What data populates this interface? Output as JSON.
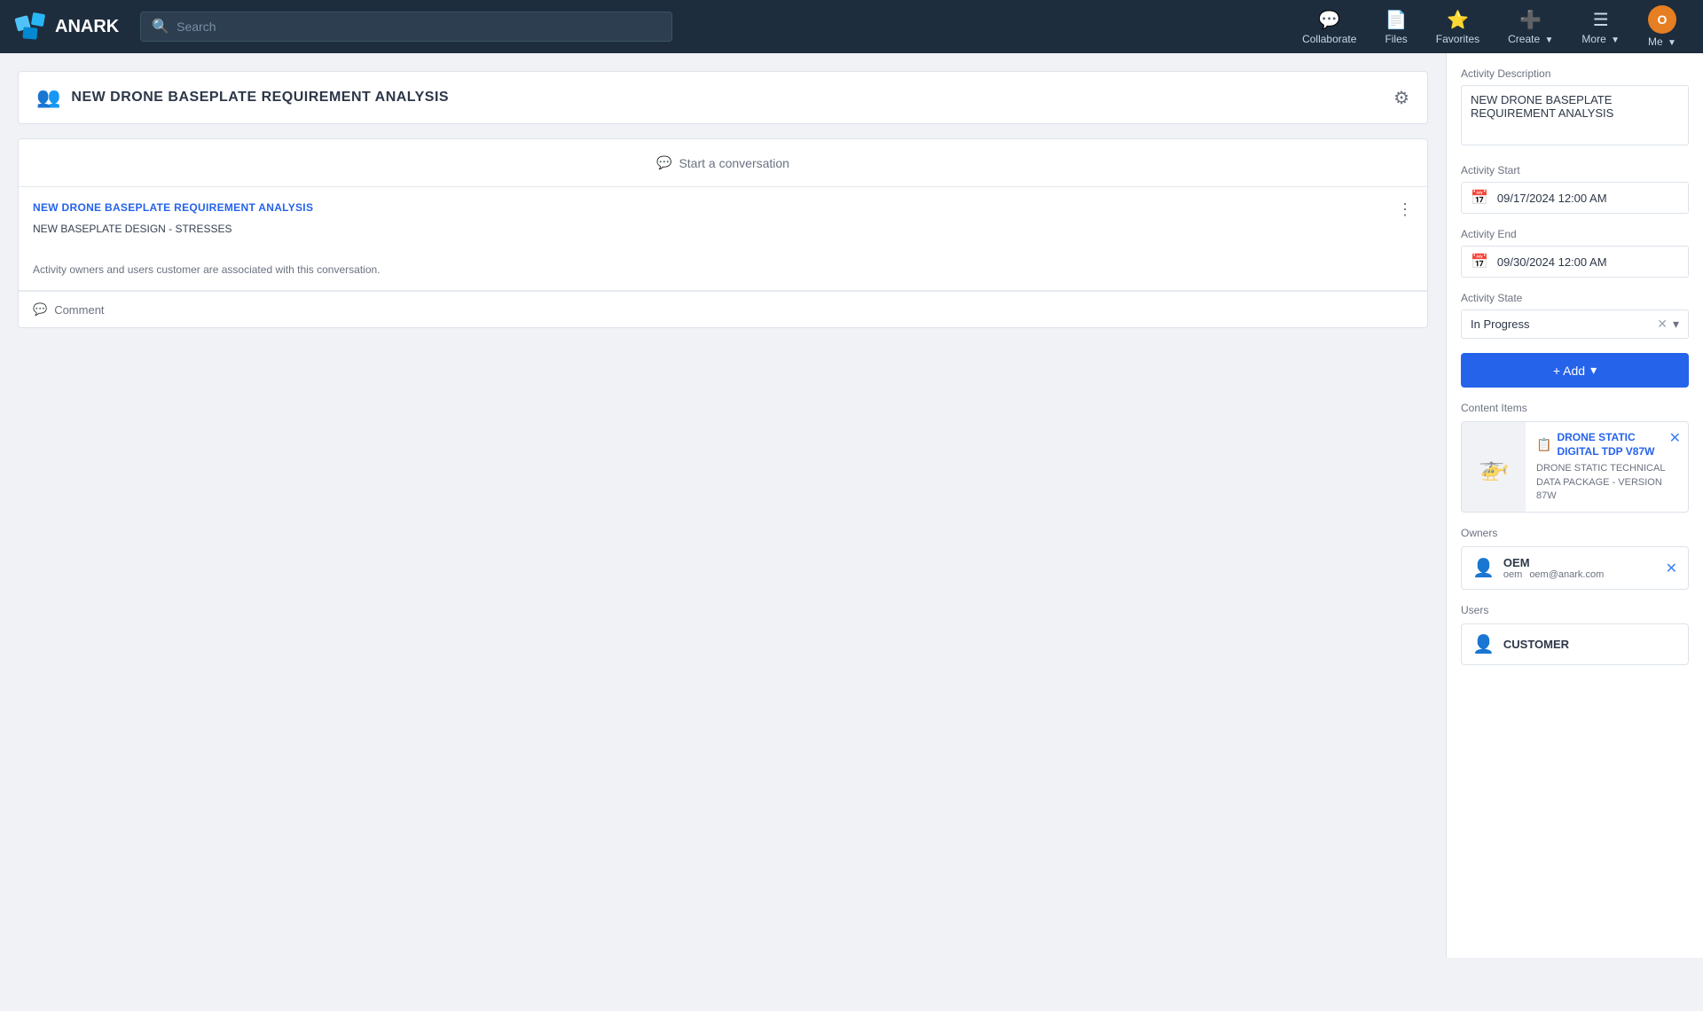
{
  "nav": {
    "logo_text": "ANARK",
    "search_placeholder": "Search",
    "items": [
      {
        "id": "collaborate",
        "label": "Collaborate",
        "icon": "💬"
      },
      {
        "id": "files",
        "label": "Files",
        "icon": "📄"
      },
      {
        "id": "favorites",
        "label": "Favorites",
        "icon": "⭐"
      },
      {
        "id": "create",
        "label": "Create",
        "icon": "➕",
        "has_dropdown": true
      },
      {
        "id": "more",
        "label": "More",
        "icon": "☰",
        "has_dropdown": true
      },
      {
        "id": "me",
        "label": "Me",
        "icon": "👤",
        "has_dropdown": true,
        "is_avatar": true,
        "avatar_letter": "O"
      }
    ]
  },
  "page": {
    "title": "NEW DRONE BASEPLATE REQUIREMENT ANALYSIS",
    "settings_icon": "⚙"
  },
  "conversation": {
    "start_label": "Start a conversation",
    "thread": {
      "link_text": "NEW DRONE BASEPLATE REQUIREMENT ANALYSIS",
      "subtitle": "NEW BASEPLATE DESIGN - STRESSES",
      "footer_text": "Activity owners and users customer are associated with this conversation."
    },
    "comment_label": "Comment"
  },
  "sidebar": {
    "activity_description_label": "Activity Description",
    "activity_description_value": "NEW DRONE BASEPLATE REQUIREMENT ANALYSIS",
    "activity_start_label": "Activity Start",
    "activity_start_value": "09/17/2024 12:00 AM",
    "activity_end_label": "Activity End",
    "activity_end_value": "09/30/2024 12:00 AM",
    "activity_state_label": "Activity State",
    "activity_state_value": "In Progress",
    "add_button_label": "+ Add",
    "content_items_label": "Content Items",
    "content_item": {
      "name": "DRONE STATIC DIGITAL TDP V87W",
      "description": "DRONE STATIC TECHNICAL DATA PACKAGE - VERSION 87W"
    },
    "owners_label": "Owners",
    "owner": {
      "name": "OEM",
      "username": "oem",
      "email": "oem@anark.com"
    },
    "users_label": "Users",
    "user": {
      "name": "CUSTOMER"
    }
  }
}
